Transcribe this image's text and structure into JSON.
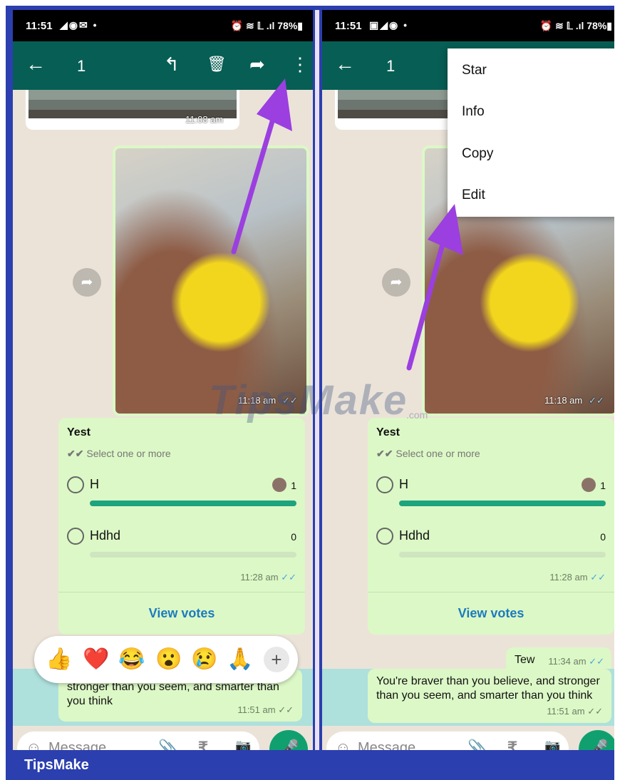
{
  "brand": "TipsMake",
  "watermark": {
    "main": "TipsMake",
    "suffix": ".com"
  },
  "left": {
    "status": {
      "time": "11:51",
      "icons_left": "◢◉✉ •",
      "icons_right": "⏰ ≋ 𝕃 .ıl 78%▮"
    },
    "appbar": {
      "back_icon": "←",
      "count": "1",
      "reply_icon": "↰",
      "delete_icon": "🗑",
      "forward_icon": "➦",
      "more_icon": "⋮"
    },
    "top_image_time": "11:08 am",
    "photo_time": "11:18 am",
    "poll": {
      "title": "Yest",
      "subtitle": "Select one or more",
      "options": [
        {
          "label": "H",
          "count": "1",
          "fill": 1.0
        },
        {
          "label": "Hdhd",
          "count": "0",
          "fill": 0.0
        }
      ],
      "time": "11:28 am",
      "view": "View votes"
    },
    "reactions": [
      "👍",
      "❤️",
      "😂",
      "😮",
      "😢",
      "🙏"
    ],
    "reaction_plus": "+",
    "message": {
      "text": "stronger than you seem, and smarter than you think",
      "time": "11:51 am"
    },
    "input": {
      "placeholder": "Message",
      "emoji_icon": "☺",
      "attach_icon": "📎",
      "rupee_icon": "₹",
      "camera_icon": "📷",
      "mic_icon": "🎤"
    }
  },
  "right": {
    "status": {
      "time": "11:51",
      "icons_left": "▣◢◉ •",
      "icons_right": "⏰ ≋ 𝕃 .ıl 78%▮"
    },
    "appbar": {
      "back_icon": "←",
      "count": "1"
    },
    "menu": [
      "Star",
      "Info",
      "Copy",
      "Edit"
    ],
    "photo_time": "11:18 am",
    "poll": {
      "title": "Yest",
      "subtitle": "Select one or more",
      "options": [
        {
          "label": "H",
          "count": "1",
          "fill": 1.0
        },
        {
          "label": "Hdhd",
          "count": "0",
          "fill": 0.0
        }
      ],
      "time": "11:28 am",
      "view": "View votes"
    },
    "tew": {
      "text": "Tew",
      "time": "11:34 am"
    },
    "message": {
      "text": "You're braver than you believe, and stronger than you seem, and smarter than you think",
      "time": "11:51 am"
    },
    "input": {
      "placeholder": "Message",
      "emoji_icon": "☺",
      "attach_icon": "📎",
      "rupee_icon": "₹",
      "camera_icon": "📷",
      "mic_icon": "🎤"
    }
  },
  "colors": {
    "appbar": "#075e54",
    "bubble": "#dcf8c6",
    "arrow": "#9b3fe0",
    "frame": "#2b3fae",
    "poll_bar": "#1da37d"
  }
}
